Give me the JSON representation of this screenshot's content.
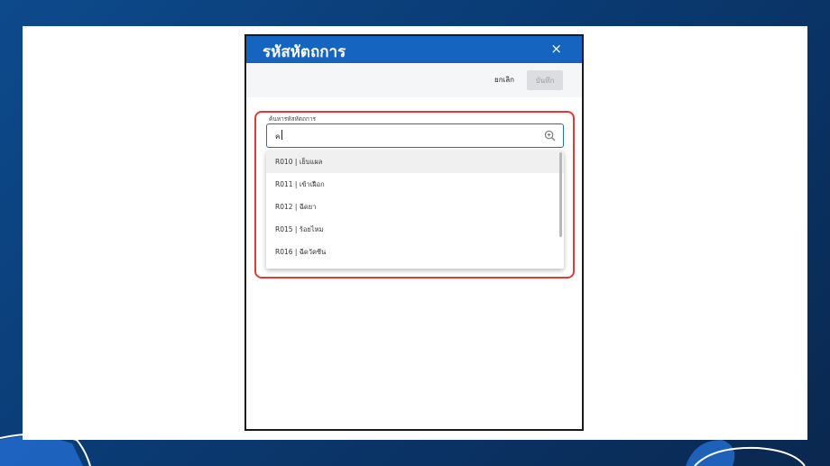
{
  "dialog": {
    "title": "รหัสหัตถการ",
    "close_label": "×",
    "cancel_label": "ยกเลิก",
    "save_label": "บันทึก"
  },
  "search": {
    "label": "ค้นหารหัสหัตถการ",
    "value": "ค"
  },
  "dropdown": {
    "items": [
      "R010 | เย็บแผล",
      "R011 | เข้าเฝือก",
      "R012 | ฉีดยา",
      "R015 | ร้อยไหม",
      "R016 | ฉีดวัคซีน"
    ],
    "active_index": 0
  },
  "colors": {
    "header_blue": "#1565c0",
    "highlight_red": "#e53935",
    "background_navy": "#0a3a72"
  }
}
